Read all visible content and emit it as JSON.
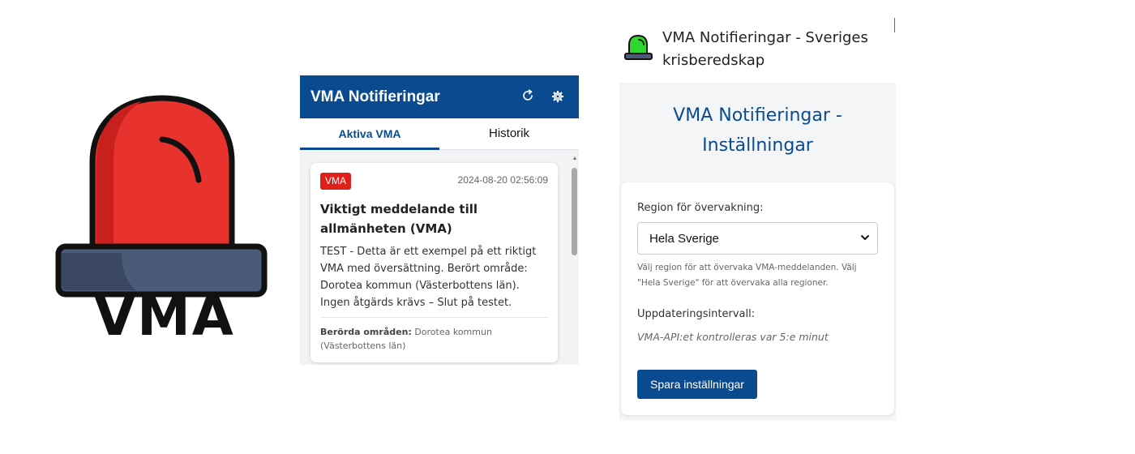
{
  "logo": {
    "text": "VMA",
    "icon": "red-siren-icon",
    "colors": {
      "light": "#e8322e",
      "shade": "#c8201d",
      "base": "#4a5a78"
    }
  },
  "popup": {
    "title": "VMA Notifieringar",
    "refresh_icon": "refresh-icon",
    "settings_icon": "gear-icon",
    "tabs": [
      {
        "label": "Aktiva VMA",
        "active": true
      },
      {
        "label": "Historik",
        "active": false
      }
    ],
    "alert": {
      "badge": "VMA",
      "timestamp": "2024-08-20 02:56:09",
      "title": "Viktigt meddelande till allmänheten (VMA)",
      "body": "TEST - Detta är ett exempel på ett riktigt VMA med översättning. Berört område: Dorotea kommun (Västerbottens län). Ingen åtgärds krävs – Slut på testet.",
      "areas_label": "Berörda områden:",
      "areas_value": "Dorotea kommun (Västerbottens län)"
    },
    "colors": {
      "header": "#0a4a8f",
      "badge": "#e0201a"
    }
  },
  "options": {
    "window_title": "VMA Notifieringar - Sveriges krisberedskap",
    "window_icon": "green-siren-icon",
    "heading": "VMA Notifieringar - Inställningar",
    "region_label": "Region för övervakning:",
    "region_value": "Hela Sverige",
    "region_help": "Välj region för att övervaka VMA-meddelanden. Välj \"Hela Sverige\" för att övervaka alla regioner.",
    "interval_label": "Uppdateringsintervall:",
    "interval_note": "VMA-API:et kontrolleras var 5:e minut",
    "save_label": "Spara inställningar",
    "colors": {
      "accent": "#0a4a8f"
    }
  }
}
